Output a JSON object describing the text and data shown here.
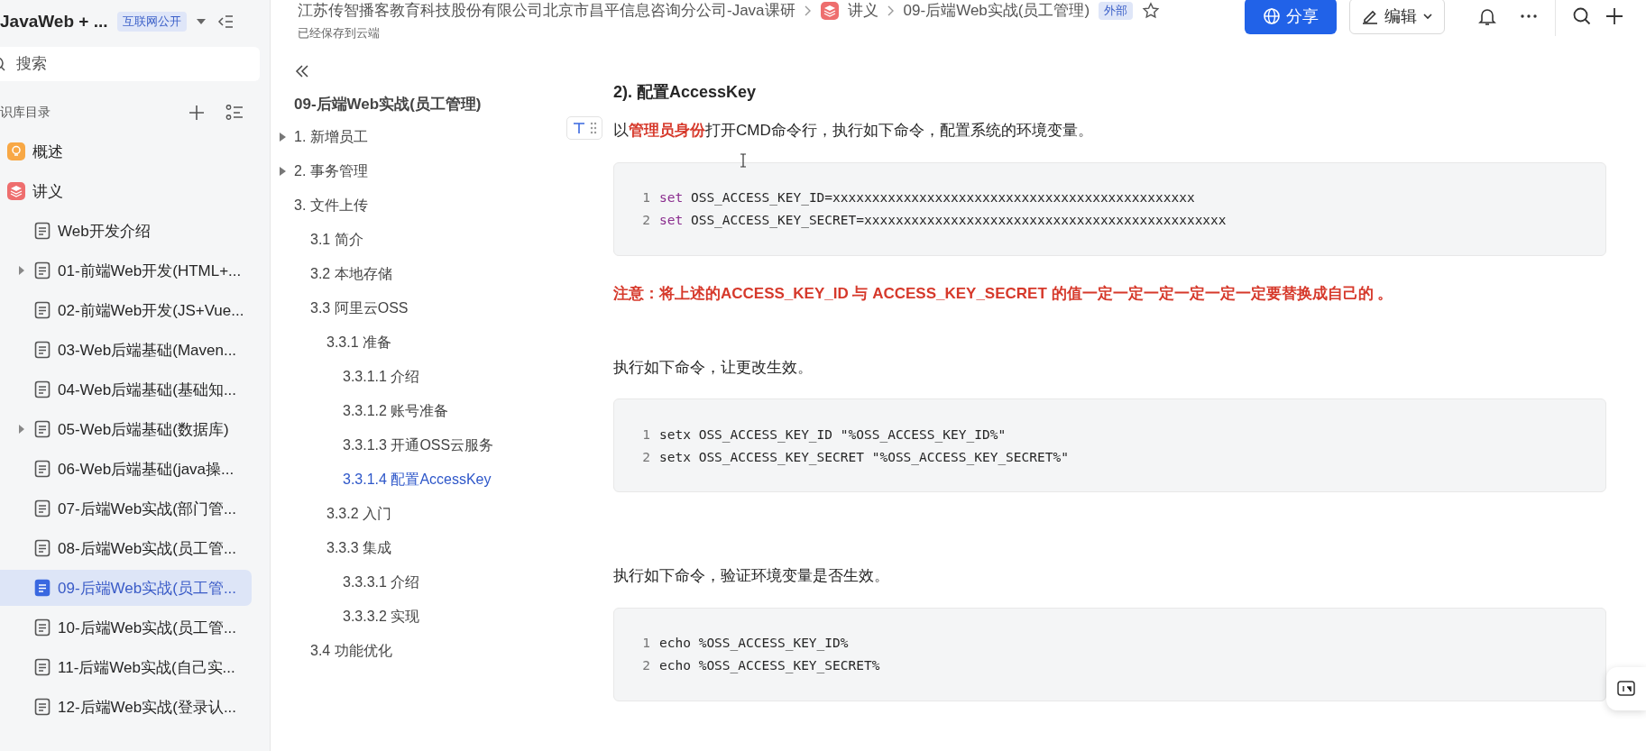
{
  "sidebar": {
    "title": "JavaWeb + ...",
    "badge": "互联网公开",
    "search": {
      "placeholder": "搜索"
    },
    "section_title": "识库目录",
    "items": [
      {
        "kind": "overview",
        "label": "概述",
        "expandable": false,
        "selected": false
      },
      {
        "kind": "lecture",
        "label": "讲义",
        "expandable": false,
        "selected": false
      },
      {
        "kind": "doc",
        "label": "Web开发介绍",
        "expandable": false,
        "selected": false
      },
      {
        "kind": "doc",
        "label": "01-前端Web开发(HTML+...",
        "expandable": true,
        "selected": false
      },
      {
        "kind": "doc",
        "label": "02-前端Web开发(JS+Vue...",
        "expandable": false,
        "selected": false
      },
      {
        "kind": "doc",
        "label": "03-Web后端基础(Maven...",
        "expandable": false,
        "selected": false
      },
      {
        "kind": "doc",
        "label": "04-Web后端基础(基础知...",
        "expandable": false,
        "selected": false
      },
      {
        "kind": "doc",
        "label": "05-Web后端基础(数据库)",
        "expandable": true,
        "selected": false
      },
      {
        "kind": "doc",
        "label": "06-Web后端基础(java操...",
        "expandable": false,
        "selected": false
      },
      {
        "kind": "doc",
        "label": "07-后端Web实战(部门管...",
        "expandable": false,
        "selected": false
      },
      {
        "kind": "doc",
        "label": "08-后端Web实战(员工管...",
        "expandable": false,
        "selected": false
      },
      {
        "kind": "doc",
        "label": "09-后端Web实战(员工管...",
        "expandable": false,
        "selected": true
      },
      {
        "kind": "doc",
        "label": "10-后端Web实战(员工管...",
        "expandable": false,
        "selected": false
      },
      {
        "kind": "doc",
        "label": "11-后端Web实战(自己实...",
        "expandable": false,
        "selected": false
      },
      {
        "kind": "doc",
        "label": "12-后端Web实战(登录认...",
        "expandable": false,
        "selected": false
      }
    ]
  },
  "header": {
    "breadcrumbs": [
      "江苏传智播客教育科技股份有限公司北京市昌平信息咨询分公司-Java课研",
      "讲义",
      "09-后端Web实战(员工管理)"
    ],
    "badge": "外部",
    "status": "已经保存到云端",
    "share_button": "分享",
    "edit_button": "编辑"
  },
  "toc": {
    "title": "09-后端Web实战(员工管理)",
    "items": [
      {
        "label": "1. 新增员工",
        "collapsed": true,
        "selected": false
      },
      {
        "label": "2. 事务管理",
        "collapsed": true,
        "selected": false
      },
      {
        "label": "3. 文件上传",
        "collapsed": false,
        "selected": false,
        "children": [
          {
            "label": "3.1 简介",
            "collapsed": false,
            "selected": false
          },
          {
            "label": "3.2 本地存储",
            "collapsed": false,
            "selected": false
          },
          {
            "label": "3.3 阿里云OSS",
            "collapsed": false,
            "selected": false,
            "children": [
              {
                "label": "3.3.1 准备",
                "collapsed": false,
                "selected": false,
                "children": [
                  {
                    "label": "3.3.1.1 介绍",
                    "collapsed": false,
                    "selected": false
                  },
                  {
                    "label": "3.3.1.2 账号准备",
                    "collapsed": false,
                    "selected": false
                  },
                  {
                    "label": "3.3.1.3 开通OSS云服务",
                    "collapsed": false,
                    "selected": false
                  },
                  {
                    "label": "3.3.1.4 配置AccessKey",
                    "collapsed": false,
                    "selected": true
                  }
                ]
              },
              {
                "label": "3.3.2 入门",
                "collapsed": false,
                "selected": false
              },
              {
                "label": "3.3.3 集成",
                "collapsed": false,
                "selected": false,
                "children": [
                  {
                    "label": "3.3.3.1 介绍",
                    "collapsed": false,
                    "selected": false
                  },
                  {
                    "label": "3.3.3.2 实现",
                    "collapsed": false,
                    "selected": false
                  }
                ]
              }
            ]
          },
          {
            "label": "3.4 功能优化",
            "collapsed": false,
            "selected": false
          }
        ]
      }
    ]
  },
  "content": [
    {
      "kind": "heading",
      "text": "2). 配置AccessKey"
    },
    {
      "kind": "paragraph",
      "text": "以**管理员身份**打开CMD命令行，执行如下命令，配置系统的环境变量。",
      "handle": true
    },
    {
      "kind": "code",
      "lines": [
        {
          "number": "1",
          "tokens": [
            {
              "kind": "keyword",
              "text": "set"
            },
            {
              "kind": "plain",
              "text": " OSS_ACCESS_KEY_ID=xxxxxxxxxxxxxxxxxxxxxxxxxxxxxxxxxxxxxxxxxxxxxx"
            }
          ]
        },
        {
          "number": "2",
          "tokens": [
            {
              "kind": "keyword",
              "text": "set"
            },
            {
              "kind": "plain",
              "text": " OSS_ACCESS_KEY_SECRET=xxxxxxxxxxxxxxxxxxxxxxxxxxxxxxxxxxxxxxxxxxxxxx"
            }
          ]
        }
      ]
    },
    {
      "kind": "warning",
      "text": "注意：将上述的ACCESS_KEY_ID  与 ACCESS_KEY_SECRET 的值一定一定一定一定一定一定要替换成自己的 。"
    },
    {
      "kind": "paragraph",
      "text": "执行如下命令，让更改生效。",
      "handle": false
    },
    {
      "kind": "code",
      "lines": [
        {
          "number": "1",
          "tokens": [
            {
              "kind": "plain",
              "text": "setx OSS_ACCESS_KEY_ID \"%OSS_ACCESS_KEY_ID%\""
            }
          ]
        },
        {
          "number": "2",
          "tokens": [
            {
              "kind": "plain",
              "text": "setx OSS_ACCESS_KEY_SECRET \"%OSS_ACCESS_KEY_SECRET%\""
            }
          ]
        }
      ]
    },
    {
      "kind": "paragraph",
      "text": "执行如下命令，验证环境变量是否生效。",
      "handle": false
    },
    {
      "kind": "code",
      "lines": [
        {
          "number": "1",
          "tokens": [
            {
              "kind": "plain",
              "text": "echo %OSS_ACCESS_KEY_ID%"
            }
          ]
        },
        {
          "number": "2",
          "tokens": [
            {
              "kind": "plain",
              "text": "echo %OSS_ACCESS_KEY_SECRET%"
            }
          ]
        }
      ]
    }
  ]
}
